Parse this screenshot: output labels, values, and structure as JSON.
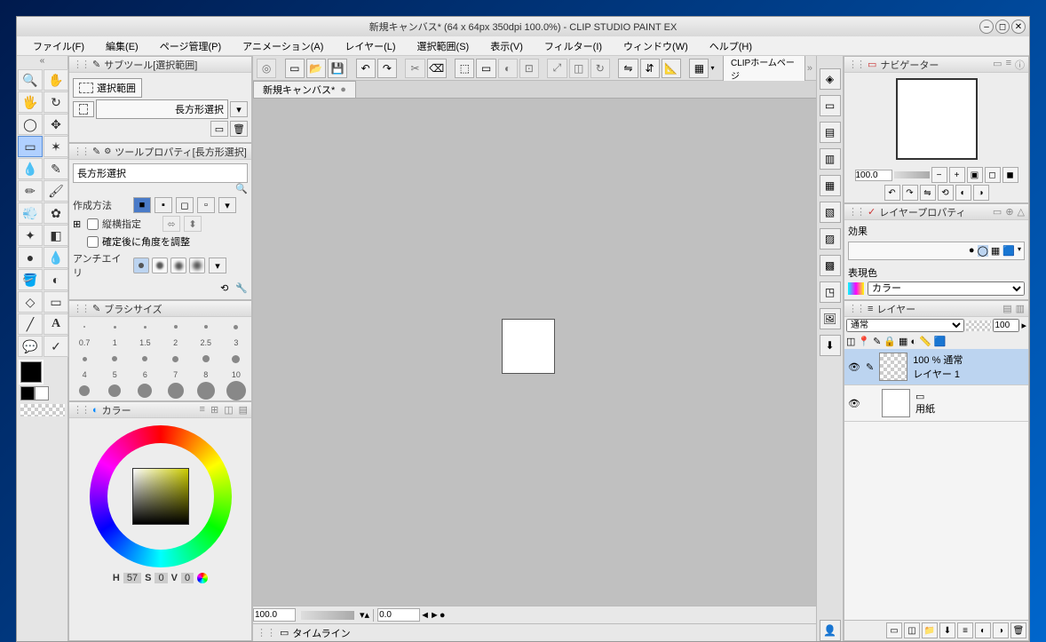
{
  "window": {
    "title": "新規キャンバス* (64 x 64px 350dpi 100.0%)   - CLIP STUDIO PAINT EX"
  },
  "menu": [
    "ファイル(F)",
    "編集(E)",
    "ページ管理(P)",
    "アニメーション(A)",
    "レイヤー(L)",
    "選択範囲(S)",
    "表示(V)",
    "フィルター(I)",
    "ウィンドウ(W)",
    "ヘルプ(H)"
  ],
  "cmdbar": {
    "homepage": "CLIPホームページ"
  },
  "subtool": {
    "title": "サブツール[選択範囲]",
    "group": "選択範囲",
    "item": "長方形選択"
  },
  "toolprop": {
    "title": "ツールプロパティ[長方形選択]",
    "name": "長方形選択",
    "method_label": "作成方法",
    "aspect_label": "縦横指定",
    "afterfix_label": "確定後に角度を調整",
    "aa_label": "アンチエイリ"
  },
  "brushsize": {
    "title": "ブラシサイズ",
    "sizes_row1": [
      "0.7",
      "1",
      "1.5",
      "2",
      "2.5",
      "3"
    ],
    "sizes_row2": [
      "4",
      "5",
      "6",
      "7",
      "8",
      "10"
    ]
  },
  "colorpanel": {
    "title": "カラー",
    "readout_H": "H",
    "readout_Hv": "57",
    "readout_S": "S",
    "readout_Sv": "0",
    "readout_V": "V",
    "readout_Vv": "0"
  },
  "doctab": {
    "name": "新規キャンバス*"
  },
  "status": {
    "zoom": "100.0",
    "rot": "0.0"
  },
  "timeline": {
    "label": "タイムライン"
  },
  "navigator": {
    "title": "ナビゲーター",
    "zoom": "100.0"
  },
  "layerprop": {
    "title": "レイヤープロパティ",
    "effect": "効果",
    "rendercolor": "表現色",
    "colormode": "カラー"
  },
  "layers": {
    "title": "レイヤー",
    "blend": "通常",
    "opacity": "100",
    "layer1_pct": "100 % 通常",
    "layer1_name": "レイヤー 1",
    "paper": "用紙"
  }
}
